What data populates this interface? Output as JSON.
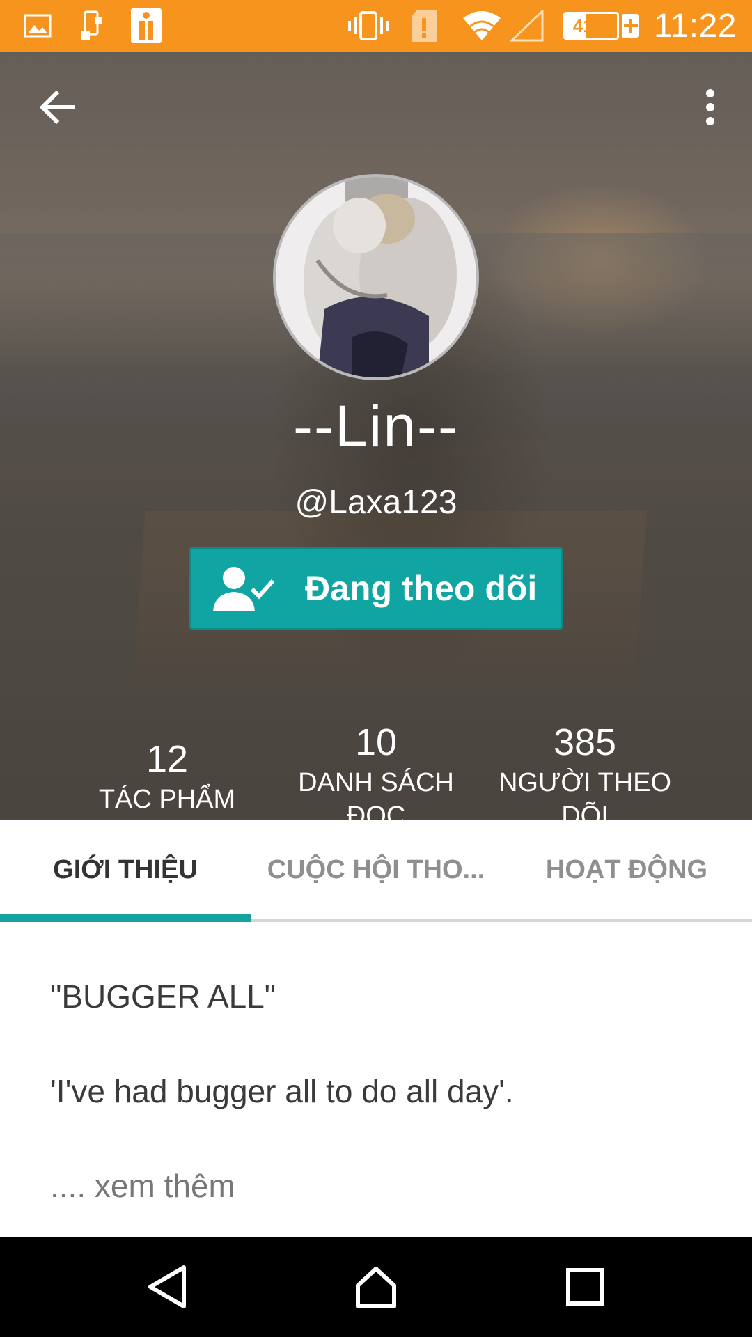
{
  "status_bar": {
    "time": "11:22",
    "battery_percent_label": "41%",
    "battery_level": 0.41,
    "left_icons": [
      "image-icon",
      "phone-sync-icon",
      "app-notification-icon"
    ],
    "right_icons": [
      "vibrate-icon",
      "sim-alert-icon",
      "wifi-icon",
      "cellular-signal-icon",
      "battery-charging-icon"
    ],
    "color": "#f7941d"
  },
  "header": {
    "back_icon": "arrow-back-icon",
    "more_icon": "more-vertical-icon"
  },
  "profile": {
    "display_name": "--Lin--",
    "username": "@Laxa123",
    "follow_button_label": "Đang theo dõi",
    "follow_icon": "person-check-icon",
    "accent_color": "#10a4a2"
  },
  "stats": [
    {
      "value": "12",
      "label_line1": "TÁC PHẨM",
      "label_line2": ""
    },
    {
      "value": "10",
      "label_line1": "DANH SÁCH",
      "label_line2": "ĐỌC"
    },
    {
      "value": "385",
      "label_line1": "NGƯỜI THEO",
      "label_line2": "DÕI"
    }
  ],
  "tabs": [
    {
      "label": "GIỚI THIỆU",
      "active": true
    },
    {
      "label": "CUỘC HỘI THO...",
      "active": false
    },
    {
      "label": "HOẠT ĐỘNG",
      "active": false
    }
  ],
  "about": {
    "title": "\"BUGGER ALL\"",
    "quote": "'I've had bugger all to do all day'.",
    "more_link": ".... xem thêm"
  },
  "nav_bar": {
    "icons": [
      "nav-back-icon",
      "nav-home-icon",
      "nav-recents-icon"
    ]
  }
}
